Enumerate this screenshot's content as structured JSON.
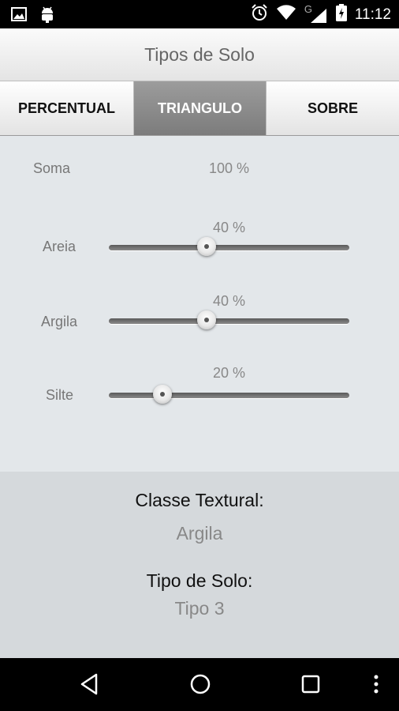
{
  "status_bar": {
    "time": "11:12",
    "network_label": "G",
    "icons": [
      "image-icon",
      "android-icon",
      "alarm-icon",
      "wifi-icon",
      "signal-icon",
      "battery-charging-icon"
    ]
  },
  "app": {
    "title": "Tipos de Solo"
  },
  "tabs": [
    {
      "label": "PERCENTUAL",
      "active": false
    },
    {
      "label": "TRIANGULO",
      "active": true
    },
    {
      "label": "SOBRE",
      "active": false
    }
  ],
  "sum": {
    "label": "Soma",
    "value": "100 %"
  },
  "sliders": [
    {
      "label": "Areia",
      "value_text": "40 %",
      "value": 40
    },
    {
      "label": "Argila",
      "value_text": "40 %",
      "value": 40
    },
    {
      "label": "Silte",
      "value_text": "20 %",
      "value": 20
    }
  ],
  "result": {
    "textural_class_label": "Classe Textural:",
    "textural_class_value": "Argila",
    "soil_type_label": "Tipo de Solo:",
    "soil_type_value": "Tipo 3"
  },
  "nav_bar": {
    "icons": [
      "back-icon",
      "home-icon",
      "recents-icon",
      "overflow-menu-icon"
    ]
  }
}
